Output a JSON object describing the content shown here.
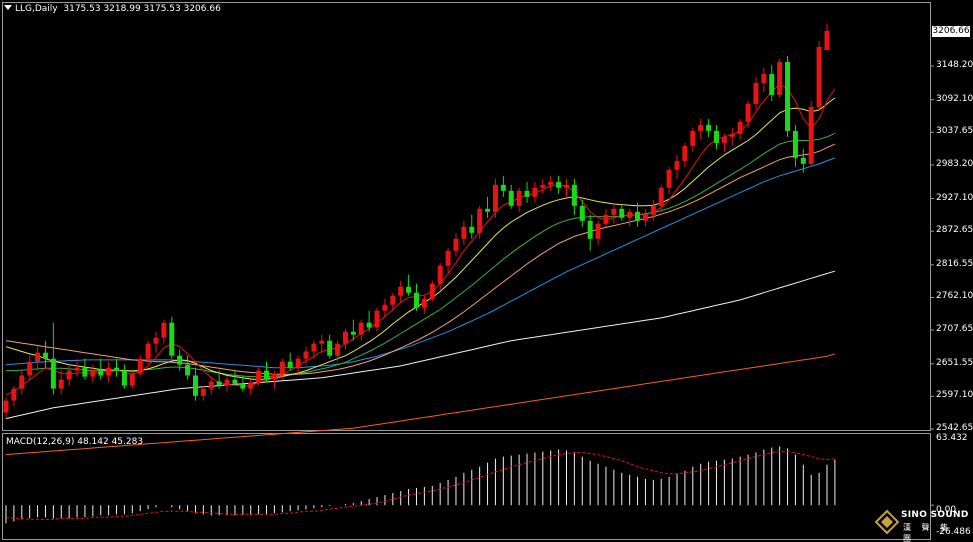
{
  "header": {
    "symbol": "LLG,Daily",
    "ohlc": "3175.53 3218.99 3175.53 3206.66"
  },
  "macd_header": {
    "label": "MACD(12,26,9) 48.142 45.283"
  },
  "price_axis": {
    "current_price": "3206.66",
    "labels": [
      "3148.20",
      "3092.10",
      "3037.65",
      "2983.20",
      "2927.10",
      "2872.65",
      "2816.55",
      "2762.10",
      "2707.65",
      "2651.55",
      "2597.10",
      "2542.65"
    ]
  },
  "macd_axis": {
    "top": "63.432",
    "zero": "0.00",
    "bottom": "-26.486"
  },
  "logo": {
    "name": "SINO SOUND",
    "sub": "漢 聲 集 團"
  },
  "colors": {
    "up": "#e81414",
    "down": "#19d919",
    "ma_red": "#e81414",
    "ma_yellow": "#e6e65c",
    "ma_green": "#3cb043",
    "ma_orange": "#f0a070",
    "ma_blue": "#2a8fe0",
    "ma_white": "#f0f0f0",
    "ma_darkorange": "#f06020",
    "signal": "#e81414",
    "hist": "#f0f0f0"
  },
  "chart_data": {
    "type": "candlestick",
    "title": "LLG,Daily",
    "ylim": [
      2542.65,
      3206.66
    ],
    "macd_ylim": [
      -26.486,
      63.432
    ],
    "candles": [
      [
        2570,
        2595,
        2560,
        2590
      ],
      [
        2590,
        2615,
        2580,
        2610
      ],
      [
        2610,
        2640,
        2600,
        2632
      ],
      [
        2632,
        2665,
        2625,
        2655
      ],
      [
        2655,
        2680,
        2640,
        2670
      ],
      [
        2670,
        2690,
        2645,
        2660
      ],
      [
        2660,
        2720,
        2600,
        2610
      ],
      [
        2610,
        2640,
        2600,
        2625
      ],
      [
        2625,
        2650,
        2615,
        2640
      ],
      [
        2640,
        2660,
        2630,
        2645
      ],
      [
        2645,
        2660,
        2625,
        2630
      ],
      [
        2630,
        2650,
        2620,
        2640
      ],
      [
        2640,
        2660,
        2625,
        2632
      ],
      [
        2632,
        2655,
        2620,
        2645
      ],
      [
        2645,
        2660,
        2630,
        2640
      ],
      [
        2640,
        2650,
        2610,
        2615
      ],
      [
        2615,
        2640,
        2610,
        2635
      ],
      [
        2635,
        2665,
        2630,
        2660
      ],
      [
        2660,
        2690,
        2650,
        2685
      ],
      [
        2685,
        2705,
        2670,
        2695
      ],
      [
        2695,
        2725,
        2685,
        2720
      ],
      [
        2720,
        2730,
        2660,
        2665
      ],
      [
        2665,
        2675,
        2640,
        2650
      ],
      [
        2650,
        2665,
        2625,
        2632
      ],
      [
        2632,
        2645,
        2590,
        2598
      ],
      [
        2598,
        2615,
        2590,
        2610
      ],
      [
        2610,
        2630,
        2600,
        2622
      ],
      [
        2622,
        2640,
        2610,
        2615
      ],
      [
        2615,
        2630,
        2605,
        2625
      ],
      [
        2625,
        2640,
        2615,
        2618
      ],
      [
        2618,
        2630,
        2605,
        2610
      ],
      [
        2610,
        2625,
        2600,
        2620
      ],
      [
        2620,
        2645,
        2615,
        2640
      ],
      [
        2640,
        2655,
        2620,
        2625
      ],
      [
        2625,
        2640,
        2610,
        2635
      ],
      [
        2635,
        2660,
        2625,
        2655
      ],
      [
        2655,
        2670,
        2640,
        2645
      ],
      [
        2645,
        2665,
        2635,
        2660
      ],
      [
        2660,
        2680,
        2650,
        2672
      ],
      [
        2672,
        2690,
        2660,
        2685
      ],
      [
        2685,
        2700,
        2670,
        2690
      ],
      [
        2690,
        2700,
        2660,
        2665
      ],
      [
        2665,
        2690,
        2655,
        2685
      ],
      [
        2685,
        2710,
        2675,
        2705
      ],
      [
        2705,
        2725,
        2690,
        2700
      ],
      [
        2700,
        2725,
        2690,
        2720
      ],
      [
        2720,
        2740,
        2705,
        2712
      ],
      [
        2712,
        2745,
        2705,
        2740
      ],
      [
        2740,
        2760,
        2730,
        2750
      ],
      [
        2750,
        2770,
        2740,
        2765
      ],
      [
        2765,
        2790,
        2755,
        2780
      ],
      [
        2780,
        2800,
        2765,
        2770
      ],
      [
        2770,
        2785,
        2740,
        2745
      ],
      [
        2745,
        2765,
        2735,
        2760
      ],
      [
        2760,
        2790,
        2755,
        2785
      ],
      [
        2785,
        2820,
        2775,
        2815
      ],
      [
        2815,
        2845,
        2800,
        2840
      ],
      [
        2840,
        2870,
        2830,
        2860
      ],
      [
        2860,
        2890,
        2850,
        2880
      ],
      [
        2880,
        2900,
        2860,
        2870
      ],
      [
        2870,
        2915,
        2860,
        2910
      ],
      [
        2910,
        2930,
        2895,
        2905
      ],
      [
        2905,
        2960,
        2895,
        2950
      ],
      [
        2950,
        2965,
        2930,
        2940
      ],
      [
        2940,
        2950,
        2910,
        2915
      ],
      [
        2915,
        2945,
        2905,
        2940
      ],
      [
        2940,
        2955,
        2920,
        2930
      ],
      [
        2930,
        2955,
        2920,
        2945
      ],
      [
        2945,
        2960,
        2935,
        2950
      ],
      [
        2950,
        2965,
        2940,
        2955
      ],
      [
        2955,
        2965,
        2935,
        2945
      ],
      [
        2945,
        2960,
        2930,
        2950
      ],
      [
        2950,
        2960,
        2900,
        2915
      ],
      [
        2915,
        2925,
        2880,
        2890
      ],
      [
        2890,
        2900,
        2840,
        2860
      ],
      [
        2860,
        2890,
        2850,
        2885
      ],
      [
        2885,
        2910,
        2880,
        2900
      ],
      [
        2900,
        2920,
        2885,
        2910
      ],
      [
        2910,
        2915,
        2890,
        2895
      ],
      [
        2895,
        2910,
        2880,
        2905
      ],
      [
        2905,
        2920,
        2880,
        2890
      ],
      [
        2890,
        2910,
        2880,
        2900
      ],
      [
        2900,
        2925,
        2890,
        2915
      ],
      [
        2915,
        2950,
        2905,
        2945
      ],
      [
        2945,
        2980,
        2935,
        2975
      ],
      [
        2975,
        3000,
        2960,
        2990
      ],
      [
        2990,
        3020,
        2980,
        3015
      ],
      [
        3015,
        3045,
        3005,
        3040
      ],
      [
        3040,
        3060,
        3025,
        3050
      ],
      [
        3050,
        3060,
        3030,
        3040
      ],
      [
        3040,
        3050,
        3010,
        3020
      ],
      [
        3020,
        3035,
        3005,
        3030
      ],
      [
        3030,
        3045,
        3015,
        3035
      ],
      [
        3035,
        3060,
        3025,
        3055
      ],
      [
        3055,
        3090,
        3045,
        3085
      ],
      [
        3085,
        3130,
        3075,
        3120
      ],
      [
        3120,
        3145,
        3105,
        3135
      ],
      [
        3135,
        3150,
        3090,
        3100
      ],
      [
        3100,
        3160,
        3095,
        3155
      ],
      [
        3155,
        3165,
        3030,
        3040
      ],
      [
        3040,
        3050,
        2980,
        2995
      ],
      [
        2995,
        3010,
        2970,
        2985
      ],
      [
        2985,
        3090,
        2980,
        3080
      ],
      [
        3080,
        3190,
        3075,
        3180
      ],
      [
        3175,
        3219,
        3175,
        3207
      ]
    ],
    "ma_fast": [
      2600,
      2605,
      2615,
      2625,
      2635,
      2645,
      2640,
      2636,
      2634,
      2636,
      2636,
      2636,
      2637,
      2638,
      2640,
      2638,
      2634,
      2638,
      2648,
      2662,
      2678,
      2685,
      2680,
      2668,
      2655,
      2640,
      2628,
      2620,
      2616,
      2616,
      2614,
      2615,
      2620,
      2624,
      2628,
      2634,
      2640,
      2648,
      2656,
      2664,
      2672,
      2676,
      2678,
      2685,
      2693,
      2702,
      2710,
      2720,
      2730,
      2742,
      2754,
      2762,
      2764,
      2766,
      2772,
      2785,
      2802,
      2820,
      2840,
      2856,
      2872,
      2888,
      2904,
      2916,
      2922,
      2928,
      2932,
      2936,
      2942,
      2948,
      2950,
      2948,
      2938,
      2922,
      2905,
      2895,
      2892,
      2895,
      2898,
      2900,
      2900,
      2900,
      2904,
      2912,
      2925,
      2942,
      2960,
      2980,
      3000,
      3016,
      3026,
      3030,
      3034,
      3040,
      3052,
      3072,
      3090,
      3105,
      3118,
      3110,
      3090,
      3060,
      3045,
      3060,
      3090,
      3110
    ],
    "ma_yellow": [
      2680,
      2676,
      2672,
      2668,
      2665,
      2660,
      2656,
      2653,
      2650,
      2648,
      2646,
      2644,
      2642,
      2641,
      2641,
      2640,
      2639,
      2640,
      2643,
      2647,
      2652,
      2656,
      2658,
      2657,
      2652,
      2646,
      2640,
      2636,
      2632,
      2630,
      2628,
      2626,
      2625,
      2626,
      2628,
      2630,
      2633,
      2636,
      2640,
      2645,
      2650,
      2655,
      2660,
      2665,
      2672,
      2680,
      2688,
      2697,
      2707,
      2718,
      2728,
      2738,
      2746,
      2754,
      2762,
      2772,
      2784,
      2796,
      2810,
      2824,
      2838,
      2852,
      2866,
      2878,
      2888,
      2896,
      2904,
      2910,
      2916,
      2921,
      2925,
      2928,
      2930,
      2928,
      2925,
      2922,
      2920,
      2918,
      2917,
      2916,
      2915,
      2915,
      2916,
      2920,
      2926,
      2934,
      2944,
      2956,
      2968,
      2980,
      2990,
      3000,
      3008,
      3016,
      3024,
      3034,
      3046,
      3058,
      3070,
      3076,
      3078,
      3076,
      3072,
      3075,
      3085,
      3095
    ],
    "ma_green": [
      2640,
      2640,
      2641,
      2642,
      2643,
      2644,
      2644,
      2644,
      2643,
      2642,
      2641,
      2640,
      2640,
      2640,
      2640,
      2640,
      2640,
      2641,
      2642,
      2643,
      2645,
      2646,
      2646,
      2645,
      2643,
      2641,
      2638,
      2636,
      2634,
      2632,
      2631,
      2630,
      2630,
      2630,
      2631,
      2632,
      2633,
      2635,
      2637,
      2640,
      2643,
      2646,
      2650,
      2654,
      2660,
      2666,
      2672,
      2679,
      2686,
      2694,
      2702,
      2710,
      2718,
      2726,
      2734,
      2742,
      2752,
      2762,
      2772,
      2782,
      2793,
      2804,
      2815,
      2826,
      2836,
      2846,
      2855,
      2864,
      2872,
      2880,
      2886,
      2891,
      2894,
      2896,
      2897,
      2897,
      2897,
      2897,
      2898,
      2899,
      2900,
      2902,
      2904,
      2907,
      2911,
      2916,
      2922,
      2929,
      2936,
      2944,
      2952,
      2960,
      2968,
      2976,
      2984,
      2993,
      3002,
      3010,
      3018,
      3022,
      3024,
      3024,
      3024,
      3026,
      3030,
      3036
    ],
    "ma_orange": [
      2690,
      2688,
      2686,
      2684,
      2682,
      2680,
      2678,
      2676,
      2674,
      2672,
      2670,
      2668,
      2666,
      2664,
      2662,
      2660,
      2658,
      2657,
      2656,
      2655,
      2655,
      2654,
      2653,
      2652,
      2650,
      2648,
      2646,
      2644,
      2642,
      2640,
      2638,
      2637,
      2636,
      2635,
      2634,
      2634,
      2634,
      2634,
      2635,
      2636,
      2638,
      2640,
      2642,
      2645,
      2648,
      2652,
      2656,
      2661,
      2666,
      2672,
      2678,
      2684,
      2690,
      2697,
      2704,
      2712,
      2720,
      2729,
      2738,
      2748,
      2758,
      2768,
      2778,
      2788,
      2798,
      2808,
      2818,
      2827,
      2836,
      2844,
      2852,
      2858,
      2864,
      2868,
      2872,
      2876,
      2879,
      2882,
      2885,
      2888,
      2891,
      2894,
      2897,
      2901,
      2905,
      2910,
      2915,
      2921,
      2927,
      2934,
      2941,
      2948,
      2955,
      2962,
      2968,
      2974,
      2980,
      2986,
      2992,
      2996,
      2998,
      3000,
      3002,
      3006,
      3012,
      3018
    ],
    "ma_blue": [
      2650,
      2651,
      2652,
      2653,
      2654,
      2655,
      2656,
      2656,
      2657,
      2657,
      2658,
      2658,
      2658,
      2658,
      2658,
      2658,
      2658,
      2658,
      2658,
      2658,
      2658,
      2658,
      2657,
      2656,
      2655,
      2654,
      2653,
      2652,
      2651,
      2650,
      2649,
      2648,
      2647,
      2646,
      2645,
      2645,
      2645,
      2645,
      2646,
      2647,
      2648,
      2649,
      2651,
      2653,
      2655,
      2658,
      2661,
      2664,
      2668,
      2672,
      2676,
      2680,
      2685,
      2690,
      2695,
      2700,
      2705,
      2711,
      2717,
      2723,
      2729,
      2735,
      2742,
      2749,
      2756,
      2763,
      2770,
      2777,
      2784,
      2791,
      2798,
      2805,
      2811,
      2817,
      2823,
      2829,
      2835,
      2841,
      2847,
      2853,
      2859,
      2865,
      2871,
      2877,
      2883,
      2889,
      2895,
      2901,
      2907,
      2913,
      2919,
      2925,
      2931,
      2937,
      2943,
      2949,
      2955,
      2960,
      2965,
      2969,
      2973,
      2977,
      2981,
      2985,
      2990,
      2995
    ],
    "ma_white": [
      2560,
      2563,
      2566,
      2569,
      2572,
      2575,
      2578,
      2580,
      2582,
      2584,
      2586,
      2588,
      2590,
      2592,
      2594,
      2596,
      2598,
      2600,
      2602,
      2604,
      2606,
      2608,
      2610,
      2611,
      2612,
      2613,
      2614,
      2615,
      2616,
      2617,
      2618,
      2619,
      2620,
      2621,
      2622,
      2623,
      2624,
      2625,
      2626,
      2627,
      2628,
      2630,
      2632,
      2634,
      2636,
      2638,
      2640,
      2642,
      2644,
      2646,
      2648,
      2651,
      2654,
      2657,
      2660,
      2663,
      2666,
      2669,
      2672,
      2675,
      2678,
      2681,
      2684,
      2687,
      2690,
      2692,
      2694,
      2696,
      2698,
      2700,
      2702,
      2704,
      2706,
      2708,
      2710,
      2712,
      2714,
      2716,
      2718,
      2720,
      2722,
      2724,
      2726,
      2728,
      2731,
      2734,
      2737,
      2740,
      2743,
      2746,
      2749,
      2752,
      2755,
      2758,
      2762,
      2766,
      2770,
      2774,
      2778,
      2782,
      2786,
      2790,
      2794,
      2798,
      2802,
      2806
    ],
    "ma_darkorange": [
      2500,
      2501,
      2502,
      2503,
      2504,
      2505,
      2506,
      2507,
      2508,
      2509,
      2510,
      2511,
      2512,
      2513,
      2514,
      2515,
      2516,
      2517,
      2518,
      2519,
      2520,
      2521,
      2522,
      2523,
      2524,
      2525,
      2526,
      2527,
      2528,
      2529,
      2530,
      2531,
      2532,
      2533,
      2534,
      2535,
      2536,
      2537,
      2538,
      2539,
      2540,
      2541,
      2542,
      2543,
      2544,
      2546,
      2548,
      2550,
      2552,
      2554,
      2556,
      2558,
      2560,
      2562,
      2564,
      2566,
      2568,
      2570,
      2572,
      2574,
      2576,
      2578,
      2580,
      2582,
      2584,
      2586,
      2588,
      2590,
      2592,
      2594,
      2596,
      2598,
      2600,
      2602,
      2604,
      2606,
      2608,
      2610,
      2612,
      2614,
      2616,
      2618,
      2620,
      2622,
      2624,
      2626,
      2628,
      2630,
      2632,
      2634,
      2636,
      2638,
      2640,
      2642,
      2644,
      2646,
      2648,
      2650,
      2652,
      2654,
      2656,
      2658,
      2660,
      2662,
      2664,
      2668
    ],
    "macd_hist": [
      -18,
      -16,
      -14,
      -13,
      -12,
      -12,
      -13,
      -13,
      -13,
      -12,
      -12,
      -11,
      -10,
      -10,
      -9,
      -9,
      -8,
      -6,
      -4,
      -2,
      0,
      -2,
      -4,
      -6,
      -8,
      -9,
      -10,
      -10,
      -10,
      -10,
      -10,
      -10,
      -9,
      -9,
      -8,
      -7,
      -6,
      -5,
      -4,
      -3,
      -2,
      -1,
      0,
      1,
      2,
      4,
      6,
      8,
      10,
      12,
      14,
      16,
      17,
      18,
      19,
      22,
      25,
      28,
      32,
      35,
      38,
      42,
      46,
      48,
      49,
      50,
      51,
      52,
      53,
      54,
      55,
      54,
      52,
      48,
      44,
      41,
      38,
      35,
      32,
      30,
      28,
      26,
      25,
      26,
      28,
      31,
      34,
      38,
      41,
      43,
      44,
      45,
      46,
      48,
      50,
      52,
      55,
      57,
      58,
      56,
      50,
      40,
      30,
      32,
      40,
      45
    ],
    "macd_signal": [
      -12,
      -13,
      -13,
      -14,
      -14,
      -14,
      -14,
      -13,
      -13,
      -13,
      -13,
      -12,
      -12,
      -12,
      -11,
      -11,
      -10,
      -9,
      -8,
      -7,
      -6,
      -6,
      -6,
      -6,
      -7,
      -7,
      -8,
      -8,
      -9,
      -9,
      -9,
      -9,
      -9,
      -9,
      -9,
      -8,
      -8,
      -7,
      -6,
      -6,
      -5,
      -4,
      -3,
      -2,
      -1,
      0,
      1,
      2,
      4,
      6,
      8,
      10,
      11,
      13,
      14,
      16,
      18,
      20,
      22,
      25,
      27,
      30,
      33,
      35,
      38,
      40,
      42,
      44,
      46,
      48,
      50,
      51,
      52,
      52,
      51,
      50,
      48,
      46,
      44,
      41,
      38,
      36,
      34,
      32,
      31,
      31,
      32,
      33,
      34,
      36,
      38,
      40,
      42,
      44,
      46,
      48,
      50,
      52,
      53,
      53,
      52,
      50,
      48,
      46,
      45,
      46
    ]
  }
}
